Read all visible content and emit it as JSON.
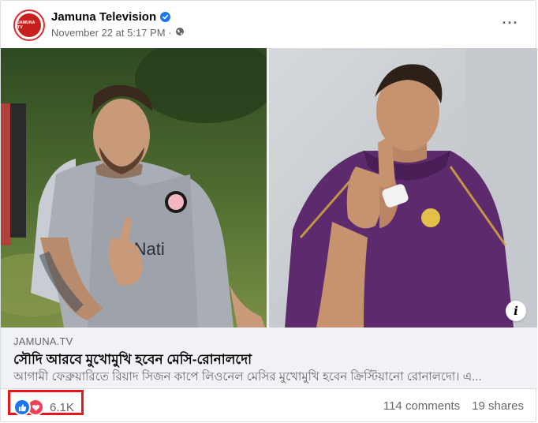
{
  "post": {
    "page_name": "Jamuna Television",
    "avatar_text": "JAMUNA TV",
    "timestamp": "November 22 at 5:17 PM",
    "separator": "·",
    "privacy_icon": "globe-icon",
    "verified_icon": "verified-badge-icon",
    "more_icon": "more-options-icon",
    "more_label": "···"
  },
  "link_preview": {
    "domain": "JAMUNA.TV",
    "headline": "সৌদি আরবে মুখোমুখি হবেন মেসি-রোনালদো",
    "subtitle": "আগামী ফেব্রুয়ারিতে রিয়াদ সিজন কাপে লিওনেল মেসির মুখোমুখি হবেন ক্রিস্টিয়ানো রোনালদো। এ...",
    "info_label": "i"
  },
  "engagement": {
    "reaction_icons": [
      "like-reaction-icon",
      "love-reaction-icon"
    ],
    "reaction_count": "6.1K",
    "comments": "114 comments",
    "shares": "19 shares"
  },
  "colors": {
    "accent": "#1877f2",
    "love": "#f33e58",
    "highlight": "#e8161c",
    "secondary_text": "#65676b",
    "preview_bg": "#f0f2f5"
  }
}
